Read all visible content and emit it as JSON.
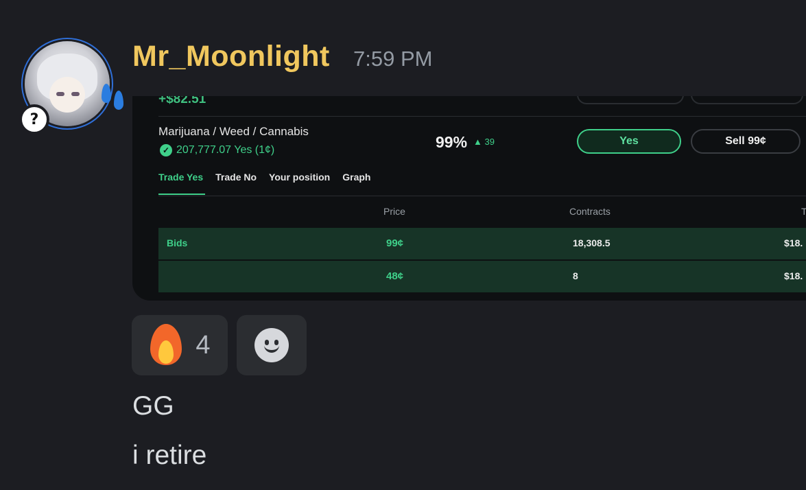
{
  "message": {
    "username": "Mr_Moonlight",
    "timestamp": "7:59 PM",
    "lines": [
      "GG",
      "i retire"
    ]
  },
  "embed": {
    "previous_value": "+$82.51",
    "market_name": "Marijuana / Weed / Cannabis",
    "position_text": "207,777.07 Yes (1¢)",
    "chance": "99%",
    "change": "▲ 39",
    "yes_button": "Yes",
    "sell_button": "Sell 99¢",
    "tabs": [
      "Trade Yes",
      "Trade No",
      "Your position",
      "Graph"
    ],
    "columns": {
      "price": "Price",
      "contracts": "Contracts",
      "total": "T"
    },
    "rows": [
      {
        "label": "Bids",
        "price": "99¢",
        "contracts": "18,308.5",
        "total": "$18."
      },
      {
        "label": "",
        "price": "48¢",
        "contracts": "8",
        "total": "$18."
      }
    ]
  },
  "reactions": [
    {
      "emoji": "fire-icon",
      "count": "4"
    },
    {
      "emoji": "smile-icon"
    }
  ],
  "colors": {
    "username": "#f0c75e",
    "accent_green": "#3fd08a",
    "background": "#1c1d22"
  }
}
